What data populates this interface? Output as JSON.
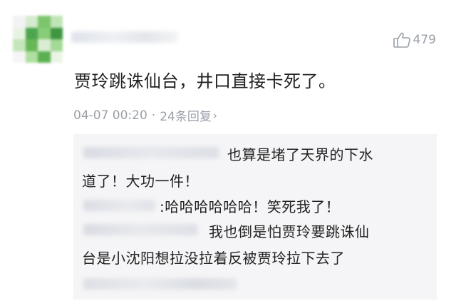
{
  "comment": {
    "likes": "479",
    "text": "贾玲跳诛仙台，井口直接卡死了。",
    "timestamp": "04-07 00:20",
    "reply_count": "24条回复",
    "separator": "·",
    "chevron": "›"
  },
  "replies": [
    {
      "line1": "也算是堵了天界的下水",
      "line2": "道了！大功一件！"
    },
    {
      "line1": ":哈哈哈哈哈哈！笑死我了！"
    },
    {
      "line1": "我也倒是怕贾玲要跳诛仙",
      "line2": "台是小沈阳想拉没拉着反被贾玲拉下去了"
    }
  ],
  "colors": {
    "text": "#222222",
    "meta": "#9aa0a8",
    "reply_bg": "#f5f5f7",
    "avatar_green": "#3a9d3c"
  },
  "icons": {
    "like": "thumbs-up-icon"
  }
}
